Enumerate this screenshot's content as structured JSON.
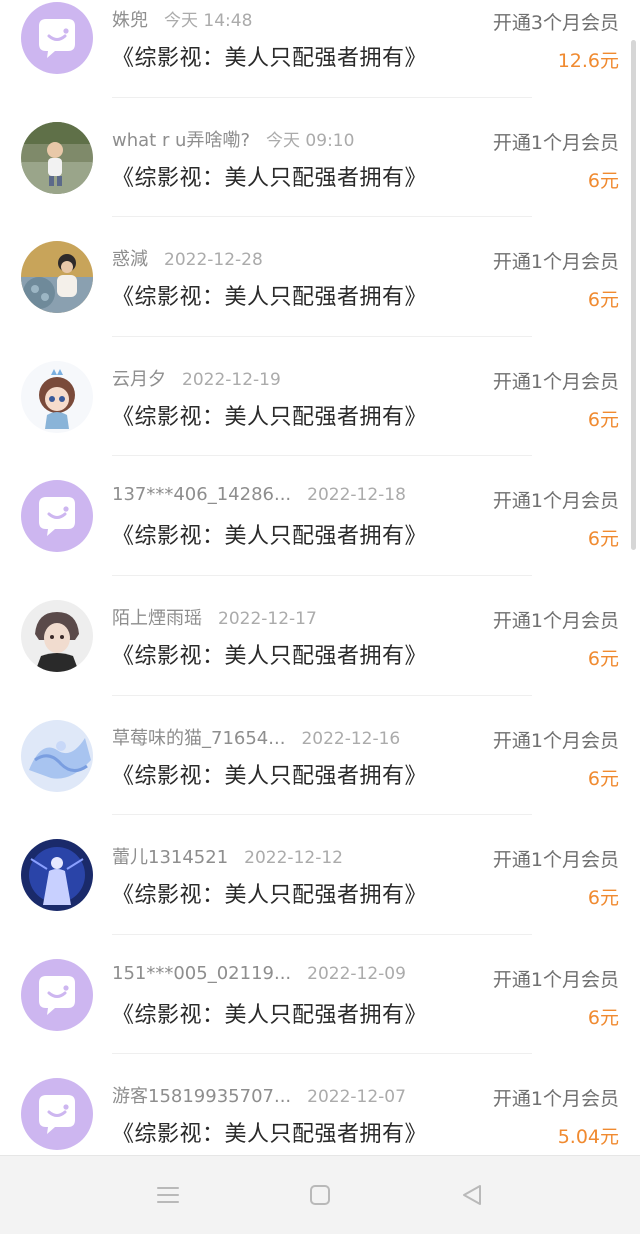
{
  "purchases": [
    {
      "user": "姝兜",
      "date": "今天 14:48",
      "title": "《综影视：美人只配强者拥有》",
      "action": "开通3个月会员",
      "amount": "12.6元",
      "avatar": "default-chat-icon"
    },
    {
      "user": "what r u弄啥嘞?",
      "date": "今天 09:10",
      "title": "《综影视：美人只配强者拥有》",
      "action": "开通1个月会员",
      "amount": "6元",
      "avatar": "photo-child"
    },
    {
      "user": "惑減",
      "date": "2022-12-28",
      "title": "《综影视：美人只配强者拥有》",
      "action": "开通1个月会员",
      "amount": "6元",
      "avatar": "photo-flowers"
    },
    {
      "user": "云月夕",
      "date": "2022-12-19",
      "title": "《综影视：美人只配强者拥有》",
      "action": "开通1个月会员",
      "amount": "6元",
      "avatar": "photo-doll"
    },
    {
      "user": "137***406_14286...",
      "date": "2022-12-18",
      "title": "《综影视：美人只配强者拥有》",
      "action": "开通1个月会员",
      "amount": "6元",
      "avatar": "default-chat-icon"
    },
    {
      "user": "陌上煙雨瑶",
      "date": "2022-12-17",
      "title": "《综影视：美人只配强者拥有》",
      "action": "开通1个月会员",
      "amount": "6元",
      "avatar": "photo-anime-boy"
    },
    {
      "user": "草莓味的猫_71654...",
      "date": "2022-12-16",
      "title": "《综影视：美人只配强者拥有》",
      "action": "开通1个月会员",
      "amount": "6元",
      "avatar": "photo-blue-art"
    },
    {
      "user": "蕾儿1314521",
      "date": "2022-12-12",
      "title": "《综影视：美人只配强者拥有》",
      "action": "开通1个月会员",
      "amount": "6元",
      "avatar": "photo-blue-figure"
    },
    {
      "user": "151***005_02119...",
      "date": "2022-12-09",
      "title": "《综影视：美人只配强者拥有》",
      "action": "开通1个月会员",
      "amount": "6元",
      "avatar": "default-chat-icon"
    },
    {
      "user": "游客15819935707...",
      "date": "2022-12-07",
      "title": "《综影视：美人只配强者拥有》",
      "action": "开通1个月会员",
      "amount": "5.04元",
      "avatar": "default-chat-icon"
    }
  ],
  "colors": {
    "amount": "#f08a30",
    "default_avatar_bg": "#cdb6f0",
    "text_primary": "#2a2a2a",
    "text_secondary": "#8e8e8e"
  },
  "navbar": {
    "icons": [
      "menu-icon",
      "home-icon",
      "back-icon"
    ]
  }
}
